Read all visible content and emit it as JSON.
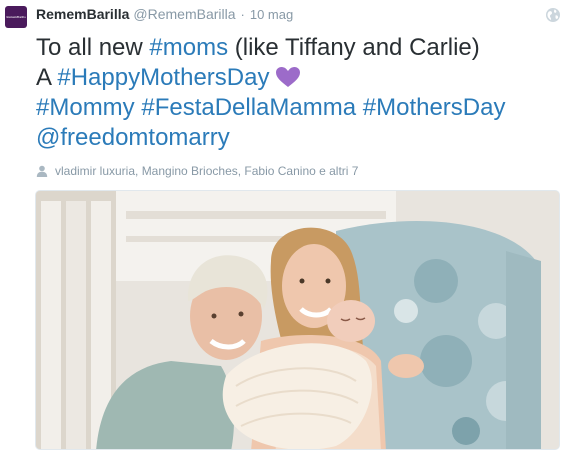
{
  "tweet": {
    "avatar_text": "RememBarilla",
    "display_name": "RememBarilla",
    "screen_name": "@RememBarilla",
    "separator": "·",
    "timestamp": "10 mag",
    "line1_plain": "To all new ",
    "line1_hashtag": "#moms",
    "line1_plain_after": " (like Tiffany and Carlie)",
    "line2_plain": "A ",
    "line2_hashtag": "#HappyMothersDay",
    "line3_hashtag1": "#Mommy",
    "line3_hashtag2": "#FestaDellaMamma",
    "line3_hashtag3": "#MothersDay",
    "line4_mention": "@freedomtomarry",
    "likes_text": "vladimir luxuria, Mangino Brioches, Fabio Canino e altri 7"
  },
  "icons": {
    "globe": "globe-icon",
    "heart": "purple-heart-emoji",
    "person": "person-icon"
  },
  "colors": {
    "link": "#2b7bb9",
    "muted": "#8899a6",
    "text": "#292f33",
    "heart": "#9c6bc9"
  }
}
